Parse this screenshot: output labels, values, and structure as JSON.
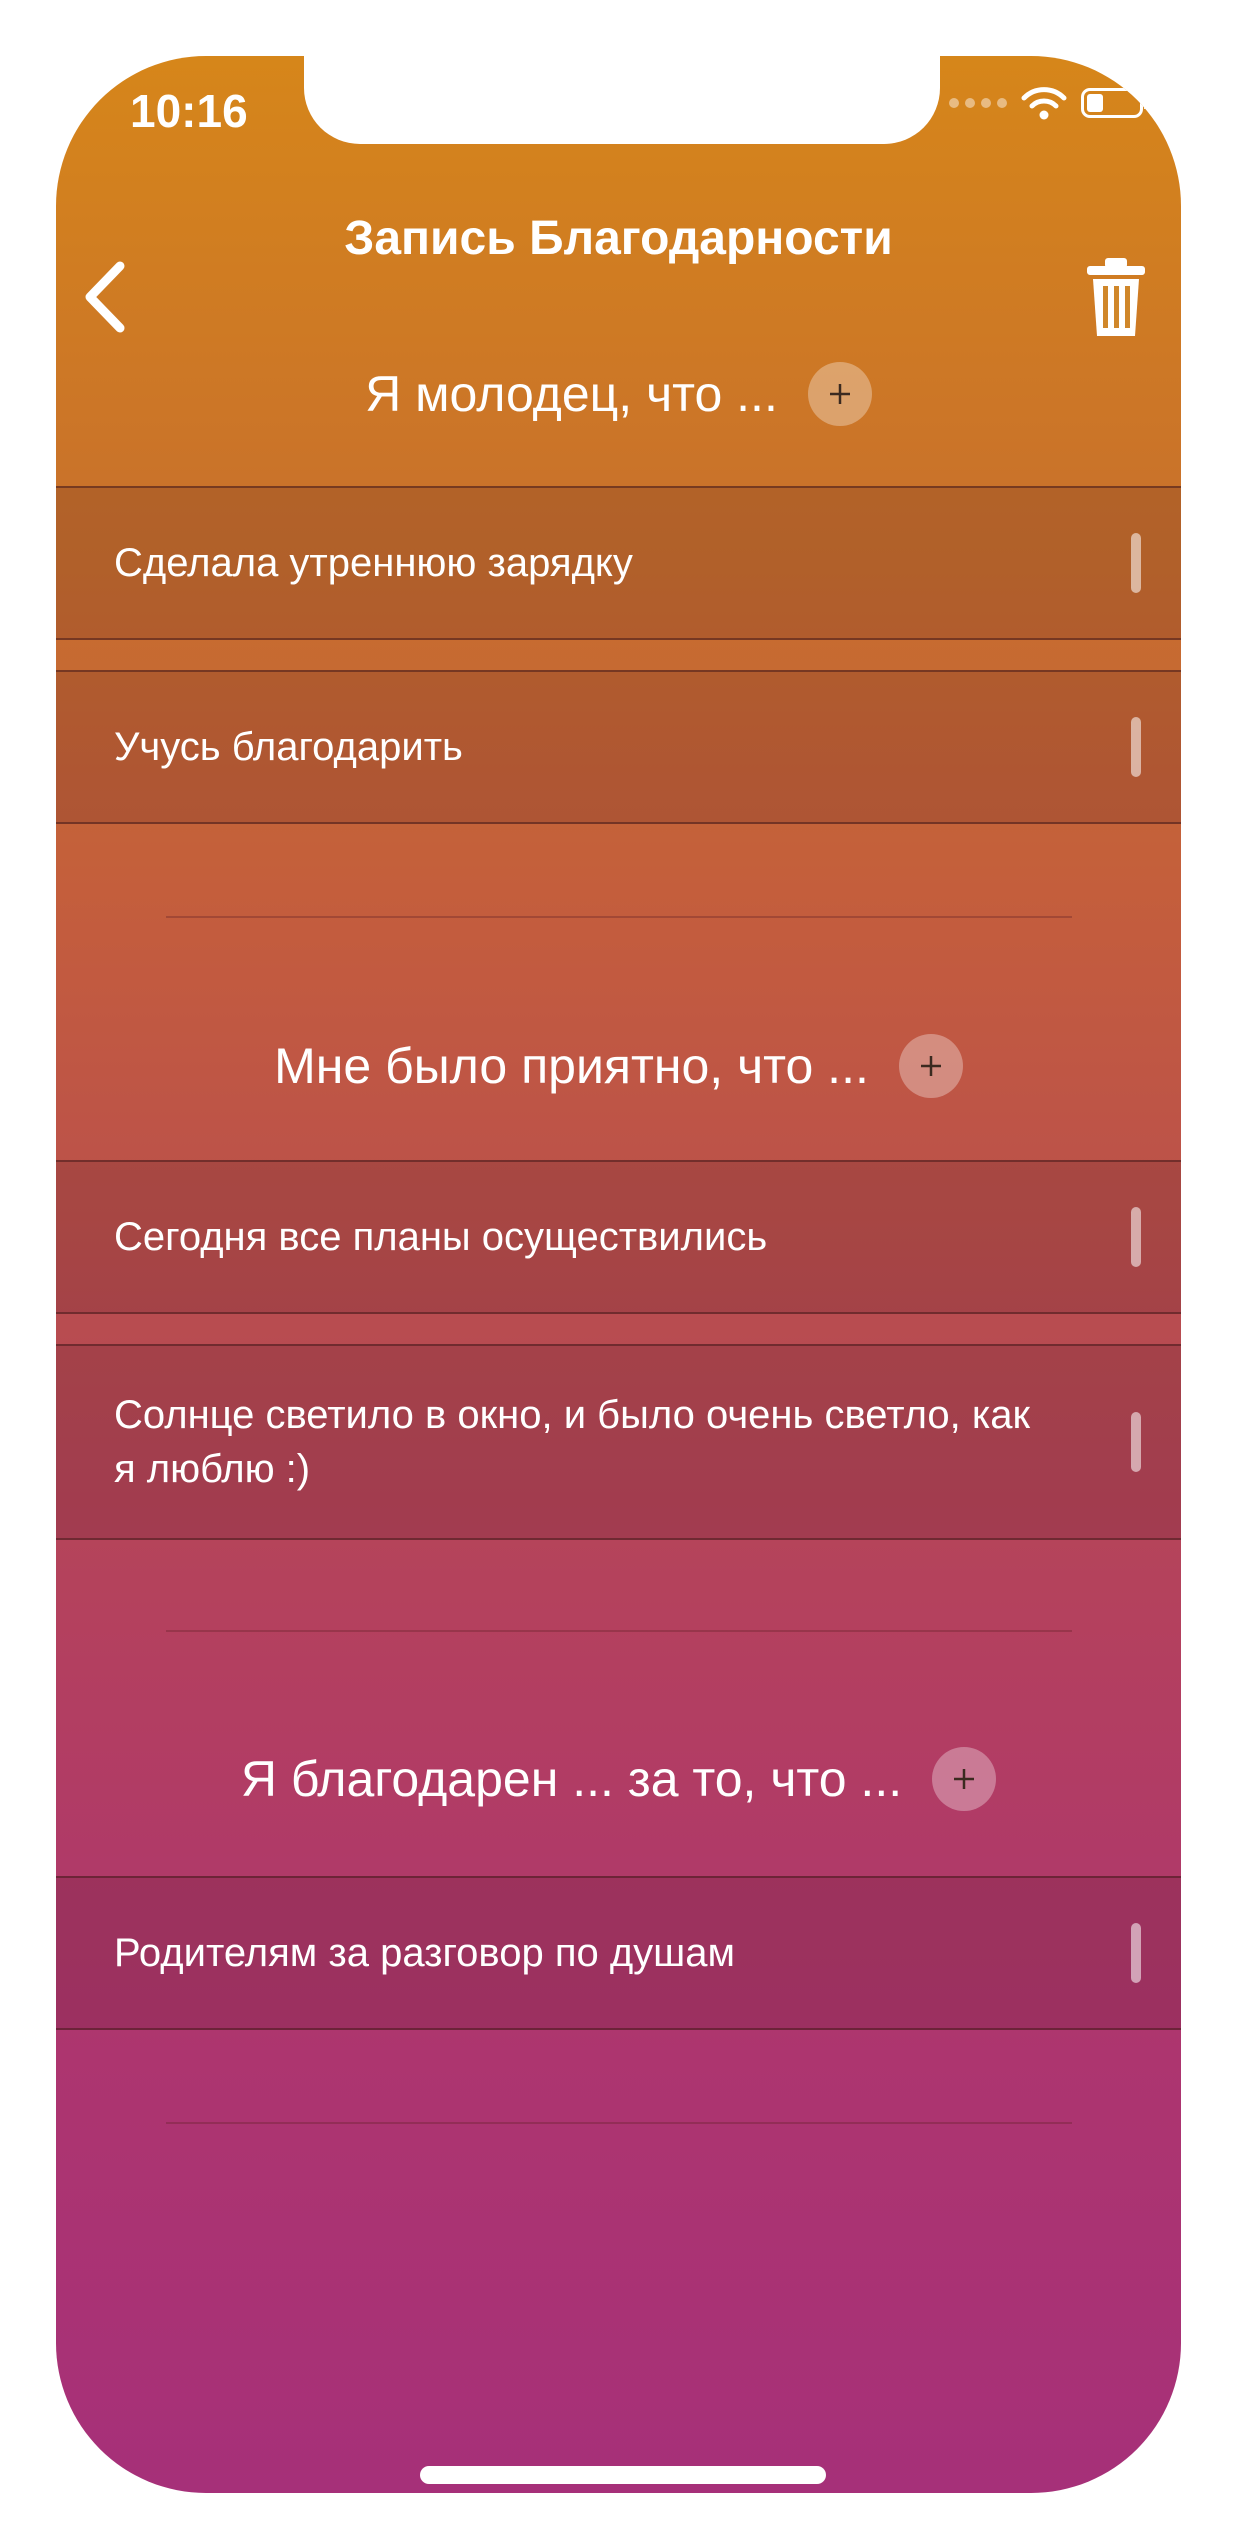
{
  "status_bar": {
    "time": "10:16"
  },
  "nav": {
    "title": "Запись Благодарности"
  },
  "sections": [
    {
      "title": "Я молодец, что ...",
      "items": [
        "Сделала утреннюю зарядку",
        "Учусь благодарить"
      ]
    },
    {
      "title": "Мне было приятно, что ...",
      "items": [
        "Сегодня все планы осуществились",
        "Солнце светило в окно, и было очень светло, как я люблю :)"
      ]
    },
    {
      "title": "Я благодарен ... за то, что ...",
      "items": [
        "Родителям за разговор по душам"
      ]
    }
  ],
  "icons": {
    "back": "chevron-left-icon",
    "trash": "trash-icon",
    "add": "plus-icon",
    "drag": "drag-handle-icon"
  },
  "colors": {
    "gradient_top": "#d6861a",
    "gradient_bottom": "#a63079",
    "text": "#ffffff"
  }
}
